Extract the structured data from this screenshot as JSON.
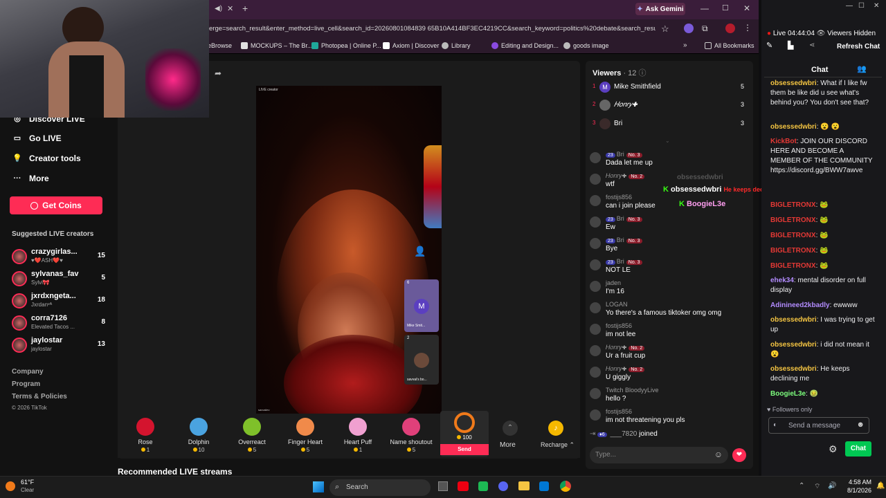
{
  "browser": {
    "ask_gemini": "Ask Gemini",
    "url": "erge=search_result&enter_method=live_cell&search_id=20260801084839 65B10A414BF3EC4219CC&search_keyword=politics%20debate&search_result_id...",
    "bookmarks": [
      "eBrowse",
      "MOCKUPS – The Br...",
      "Photopea | Online P...",
      "Axiom | Discover",
      "Library",
      "Editing and Design...",
      "goods image"
    ],
    "all_bookmarks": "All Bookmarks"
  },
  "sidebar": {
    "items": [
      {
        "label": "Discover LIVE",
        "icon": "compass-icon"
      },
      {
        "label": "Go LIVE",
        "icon": "camera-icon"
      },
      {
        "label": "Creator tools",
        "icon": "lightbulb-icon"
      },
      {
        "label": "More",
        "icon": "more-icon"
      }
    ],
    "get_coins": "Get Coins",
    "suggested_title": "Suggested LIVE creators",
    "creators": [
      {
        "name": "crazygirlas...",
        "sub": "♥❤️ASH❤️♥",
        "count": "15"
      },
      {
        "name": "sylvanas_fav",
        "sub": "Sylvi🎀",
        "count": "5"
      },
      {
        "name": "jxrdxngeta...",
        "sub": "Jxrdanᵛᴬ",
        "count": "18"
      },
      {
        "name": "corra7126",
        "sub": "Elevated Tacos ...",
        "count": "8"
      },
      {
        "name": "jaylostar",
        "sub": "jaylostar",
        "count": "13"
      }
    ],
    "footer": [
      "Company",
      "Program",
      "Terms & Policies",
      "© 2026 TikTok"
    ]
  },
  "stage": {
    "live_creator_tag": "LIVE creator",
    "streamer_tag": "savvaiiev",
    "guests": [
      {
        "count": "6",
        "initial": "M",
        "name": "Mike Smit..."
      },
      {
        "count": "2",
        "name": "savvai's bo..."
      }
    ]
  },
  "gifts": [
    {
      "name": "Rose",
      "price": "1",
      "color": "#d4142e"
    },
    {
      "name": "Dolphin",
      "price": "10",
      "color": "#4aa3e0"
    },
    {
      "name": "Overreact",
      "price": "5",
      "color": "#7fc02a"
    },
    {
      "name": "Finger Heart",
      "price": "5",
      "color": "#f08a4a"
    },
    {
      "name": "Heart Puff",
      "price": "1",
      "color": "#f0a0d0"
    },
    {
      "name": "Name shoutout",
      "price": "5",
      "color": "#e0407a"
    }
  ],
  "headset_gift": {
    "price": "100",
    "send": "Send"
  },
  "more_label": "More",
  "recharge_label": "Recharge",
  "recommended_title": "Recommended LIVE streams",
  "tiktok_chat": {
    "viewers_title": "Viewers",
    "viewers_count": "· 12",
    "top_viewers": [
      {
        "rank": "1",
        "name": "Mike Smithfield",
        "score": "5"
      },
      {
        "rank": "2",
        "name": "𝐻𝑜𝑛𝑟𝑦✚",
        "score": "3"
      },
      {
        "rank": "3",
        "name": "Bri",
        "score": "3"
      }
    ],
    "messages": [
      {
        "badge": "23",
        "name": "Bri",
        "rank": "No. 3",
        "text": "Dada let me up"
      },
      {
        "badge": "",
        "name": "𝐻𝑜𝑛𝑟𝑦✚",
        "rank": "No. 2",
        "text": "wtf"
      },
      {
        "badge": "",
        "name": "fostijs856",
        "rank": "",
        "text": "can i join please"
      },
      {
        "badge": "23",
        "name": "Bri",
        "rank": "No. 3",
        "text": "Ew"
      },
      {
        "badge": "23",
        "name": "Bri",
        "rank": "No. 3",
        "text": "Bye"
      },
      {
        "badge": "23",
        "name": "Bri",
        "rank": "No. 3",
        "text": "NOT LE"
      },
      {
        "badge": "",
        "name": "jaden",
        "rank": "",
        "text": "I'm 16"
      },
      {
        "badge": "",
        "name": "LOGAN",
        "rank": "",
        "text": "Yo there's a famous tiktoker omg omg"
      },
      {
        "badge": "",
        "name": "fostijs856",
        "rank": "",
        "text": "im not lee"
      },
      {
        "badge": "",
        "name": "𝐻𝑜𝑛𝑟𝑦✚",
        "rank": "No. 2",
        "text": "Ur a fruit cup"
      },
      {
        "badge": "",
        "name": "𝐻𝑜𝑛𝑟𝑦✚",
        "rank": "No. 2",
        "text": "U giggly"
      },
      {
        "badge": "",
        "name": "Twitch BloodyyLive",
        "rank": "",
        "text": "hello ?"
      },
      {
        "badge": "",
        "name": "fostijs856",
        "rank": "",
        "text": "im not threatening you pls"
      }
    ],
    "joined": {
      "badge": "6",
      "name": "___7820",
      "text": "joined"
    },
    "type_placeholder": "Type..."
  },
  "overlay": {
    "ghost": "obsessedwbri",
    "name1": "obsessedwbri",
    "msg1": "He keeps declining me",
    "name2": "BoogieL3e"
  },
  "twitch": {
    "live_label": "Live 04:44:04",
    "viewers_hidden": "Viewers Hidden",
    "refresh_chat": "Refresh Chat",
    "chat_title": "Chat",
    "messages": [
      {
        "user": "obsessedwbri",
        "text": "What if I like fw them be like did u see what's behind you? You don't see that?",
        "color": "#f5c542"
      },
      {
        "user": "obsessedwbri",
        "text": "😮 😮",
        "color": "#f5c542"
      },
      {
        "user": "KickBot",
        "text": "JOIN OUR DISCORD HERE AND BECOME A MEMBER OF THE COMMUNITY https://discord.gg/BWW7awve",
        "color": "#e53935"
      },
      {
        "user": "BIGLETRONX",
        "text": "🐸",
        "color": "#e53935"
      },
      {
        "user": "BIGLETRONX",
        "text": "🐸",
        "color": "#e53935"
      },
      {
        "user": "BIGLETRONX",
        "text": "🐸",
        "color": "#e53935"
      },
      {
        "user": "BIGLETRONX",
        "text": "🐸",
        "color": "#e53935"
      },
      {
        "user": "BIGLETRONX",
        "text": "🐸",
        "color": "#e53935"
      },
      {
        "user": "ehek34",
        "text": "mental disorder on full display",
        "color": "#b38cff"
      },
      {
        "user": "Adinineed2kbadly",
        "text": "ewwww",
        "color": "#b38cff"
      },
      {
        "user": "obsessedwbri",
        "text": "I was trying to get up",
        "color": "#f5c542"
      },
      {
        "user": "obsessedwbri",
        "text": "i did not mean it 😮",
        "color": "#f5c542"
      },
      {
        "user": "obsessedwbri",
        "text": "He keeps declining me",
        "color": "#f5c542"
      },
      {
        "user": "BoogieL3e",
        "text": "🤢",
        "color": "#7dff7d"
      }
    ],
    "followers_only": "Followers only",
    "send_placeholder": "Send a message",
    "chat_button": "Chat"
  },
  "taskbar": {
    "weather_temp": "61°F",
    "weather_desc": "Clear",
    "search": "Search",
    "time": "4:58 AM",
    "date": "8/1/2026"
  }
}
